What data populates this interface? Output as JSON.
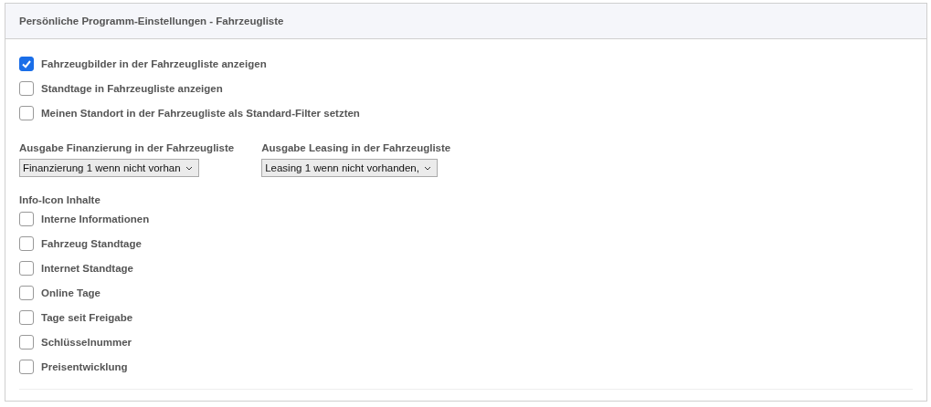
{
  "panel": {
    "title": "Persönliche Programm-Einstellungen - Fahrzeugliste"
  },
  "options": [
    {
      "label": "Fahrzeugbilder in der Fahrzeugliste anzeigen",
      "checked": true
    },
    {
      "label": "Standtage in Fahrzeugliste anzeigen",
      "checked": false
    },
    {
      "label": "Meinen Standort in der Fahrzeugliste als Standard-Filter setzten",
      "checked": false
    }
  ],
  "selects": [
    {
      "label": "Ausgabe Finanzierung in der Fahrzeugliste",
      "value": "Finanzierung 1 wenn nicht vorhan"
    },
    {
      "label": "Ausgabe Leasing in der Fahrzeugliste",
      "value": "Leasing 1 wenn nicht vorhanden,"
    }
  ],
  "info_icon": {
    "heading": "Info-Icon Inhalte",
    "items": [
      {
        "label": "Interne Informationen",
        "checked": false
      },
      {
        "label": "Fahrzeug Standtage",
        "checked": false
      },
      {
        "label": "Internet Standtage",
        "checked": false
      },
      {
        "label": "Online Tage",
        "checked": false
      },
      {
        "label": "Tage seit Freigabe",
        "checked": false
      },
      {
        "label": "Schlüsselnummer",
        "checked": false
      },
      {
        "label": "Preisentwicklung",
        "checked": false
      }
    ]
  }
}
